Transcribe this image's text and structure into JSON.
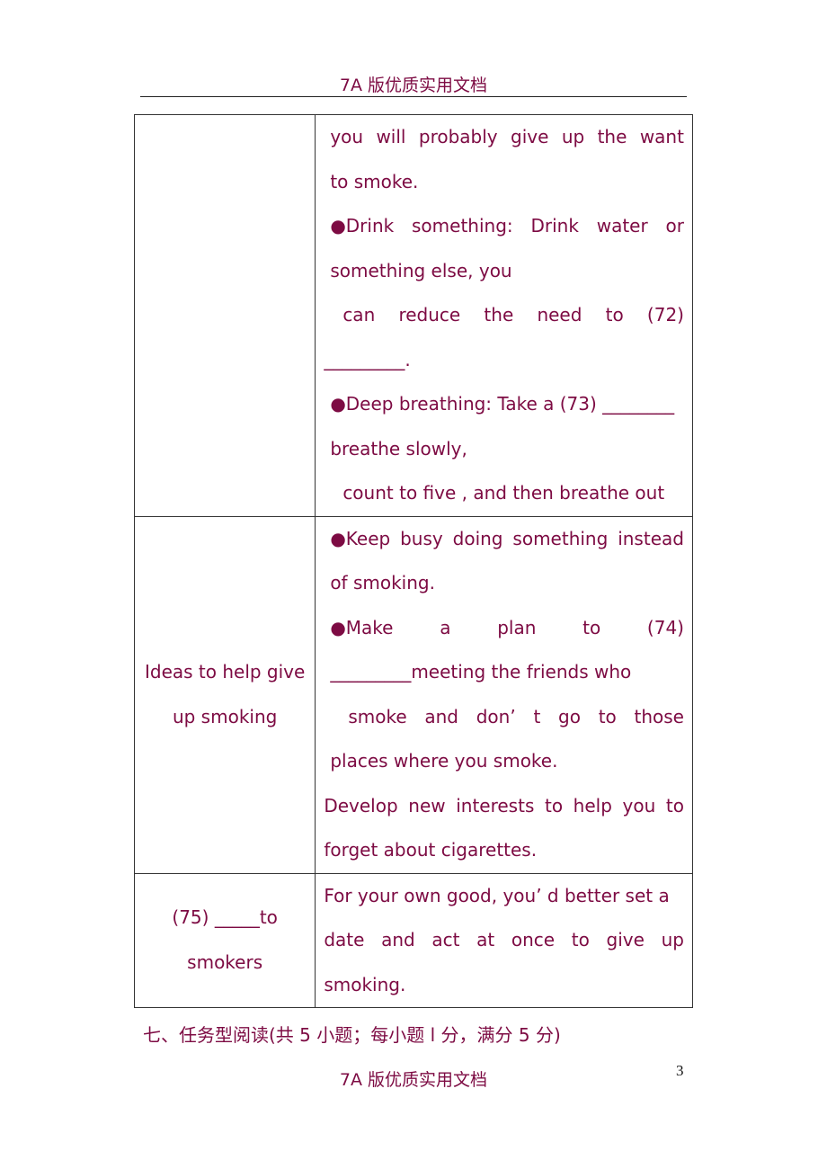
{
  "header": {
    "title": "7A 版优质实用文档"
  },
  "table": {
    "rows": [
      {
        "left_lines": [],
        "right_lines": [
          "you will probably give up the want",
          "to smoke.",
          "●Drink something: Drink water or",
          "something else, you",
          "can reduce the need to (72)",
          "_________.",
          "●Deep breathing: Take a (73) ________",
          "breathe slowly,",
          "count to five , and then breathe out"
        ]
      },
      {
        "left_lines": [
          "Ideas to help give",
          "up smoking"
        ],
        "right_lines": [
          "●Keep busy doing something instead",
          "of smoking.",
          "●Make a plan to (74)",
          "_________meeting the friends who",
          "smoke and don’ t go to those",
          "places where you smoke.",
          "Develop new interests to help you to",
          "forget about cigarettes."
        ]
      },
      {
        "left_lines": [
          "(75) _____to",
          "smokers"
        ],
        "right_lines": [
          "For your own good, you’ d better set a",
          "date and act at once to give up",
          "smoking."
        ]
      }
    ]
  },
  "section_heading": "七、任务型阅读(共 5 小题；每小题 l 分，满分 5 分)",
  "footer": {
    "title": "7A 版优质实用文档",
    "page_number": "3"
  },
  "colors": {
    "text": "#7d0b43",
    "border": "#333333"
  }
}
